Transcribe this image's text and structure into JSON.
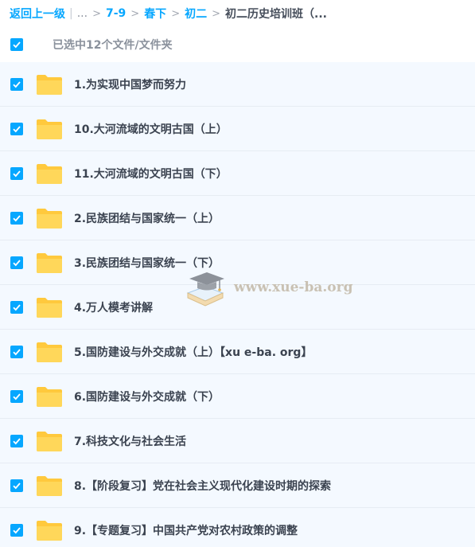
{
  "breadcrumb": {
    "back": "返回上一级",
    "ellipsis": "...",
    "items": [
      "7-9",
      "春下",
      "初二"
    ],
    "current": "初二历史培训班（..."
  },
  "selection": {
    "label": "已选中12个文件/文件夹"
  },
  "files": [
    {
      "name": "1.为实现中国梦而努力"
    },
    {
      "name": "10.大河流域的文明古国（上）"
    },
    {
      "name": "11.大河流域的文明古国（下）"
    },
    {
      "name": "2.民族团结与国家统一（上）"
    },
    {
      "name": "3.民族团结与国家统一（下）"
    },
    {
      "name": "4.万人模考讲解"
    },
    {
      "name": "5.国防建设与外交成就（上）【xu e-ba. org】"
    },
    {
      "name": "6.国防建设与外交成就（下）"
    },
    {
      "name": "7.科技文化与社会生活"
    },
    {
      "name": "8.【阶段复习】党在社会主义现代化建设时期的探索"
    },
    {
      "name": "9.【专题复习】中国共产党对农村政策的调整"
    }
  ],
  "watermark": {
    "text": "www.xue-ba.org"
  },
  "colors": {
    "accent": "#06a7ff",
    "folder": "#ffc93d",
    "row_bg": "#f4f9ff"
  },
  "icons": {
    "checkbox": "checkbox-checked-icon",
    "folder": "folder-icon",
    "watermark_logo": "graduation-cap-book-icon"
  }
}
